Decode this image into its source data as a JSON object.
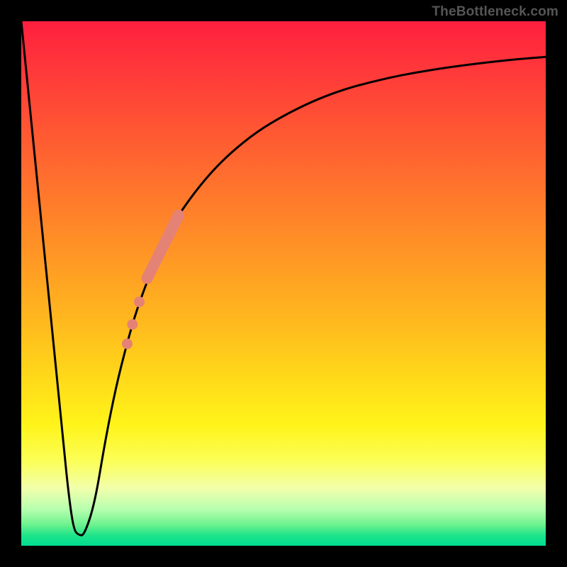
{
  "watermark": "TheBottleneck.com",
  "colors": {
    "frame": "#000000",
    "curve_stroke": "#000000",
    "highlight_fill": "#e58276",
    "gradient_stops": [
      {
        "offset": 0,
        "color": "#ff1f3e"
      },
      {
        "offset": 10,
        "color": "#ff3a3a"
      },
      {
        "offset": 22,
        "color": "#ff5a32"
      },
      {
        "offset": 34,
        "color": "#ff7a2b"
      },
      {
        "offset": 46,
        "color": "#ff9a24"
      },
      {
        "offset": 57,
        "color": "#ffb81e"
      },
      {
        "offset": 67,
        "color": "#ffd61a"
      },
      {
        "offset": 77,
        "color": "#fff41a"
      },
      {
        "offset": 84,
        "color": "#fbff59"
      },
      {
        "offset": 89,
        "color": "#f2ffab"
      },
      {
        "offset": 93,
        "color": "#b8ffb0"
      },
      {
        "offset": 96,
        "color": "#6cf28e"
      },
      {
        "offset": 98,
        "color": "#1ee38a"
      },
      {
        "offset": 100,
        "color": "#00dd90"
      }
    ]
  },
  "chart_data": {
    "type": "line",
    "title": "",
    "xlabel": "",
    "ylabel": "",
    "xlim": [
      0,
      100
    ],
    "ylim": [
      0,
      100
    ],
    "series": [
      {
        "name": "curve",
        "x": [
          0,
          2,
          4,
          6,
          8,
          9,
          10,
          11,
          12,
          14,
          16,
          18,
          20,
          22,
          25,
          28,
          32,
          36,
          40,
          45,
          50,
          55,
          60,
          65,
          70,
          75,
          80,
          85,
          90,
          95,
          100
        ],
        "y": [
          100,
          80,
          60,
          40,
          20,
          10,
          3,
          2,
          2,
          8,
          20,
          30,
          38,
          45,
          53,
          60,
          66,
          71,
          75,
          79,
          82,
          84.5,
          86.5,
          88,
          89.2,
          90.2,
          91,
          91.7,
          92.3,
          92.8,
          93.2
        ]
      }
    ],
    "highlights": {
      "thick_segment": {
        "x_start": 24,
        "x_end": 30,
        "y_start": 51,
        "y_end": 63
      },
      "dots": [
        {
          "x": 22.5,
          "y": 46.5
        },
        {
          "x": 21.2,
          "y": 42.2
        },
        {
          "x": 20.2,
          "y": 38.5
        }
      ]
    }
  }
}
